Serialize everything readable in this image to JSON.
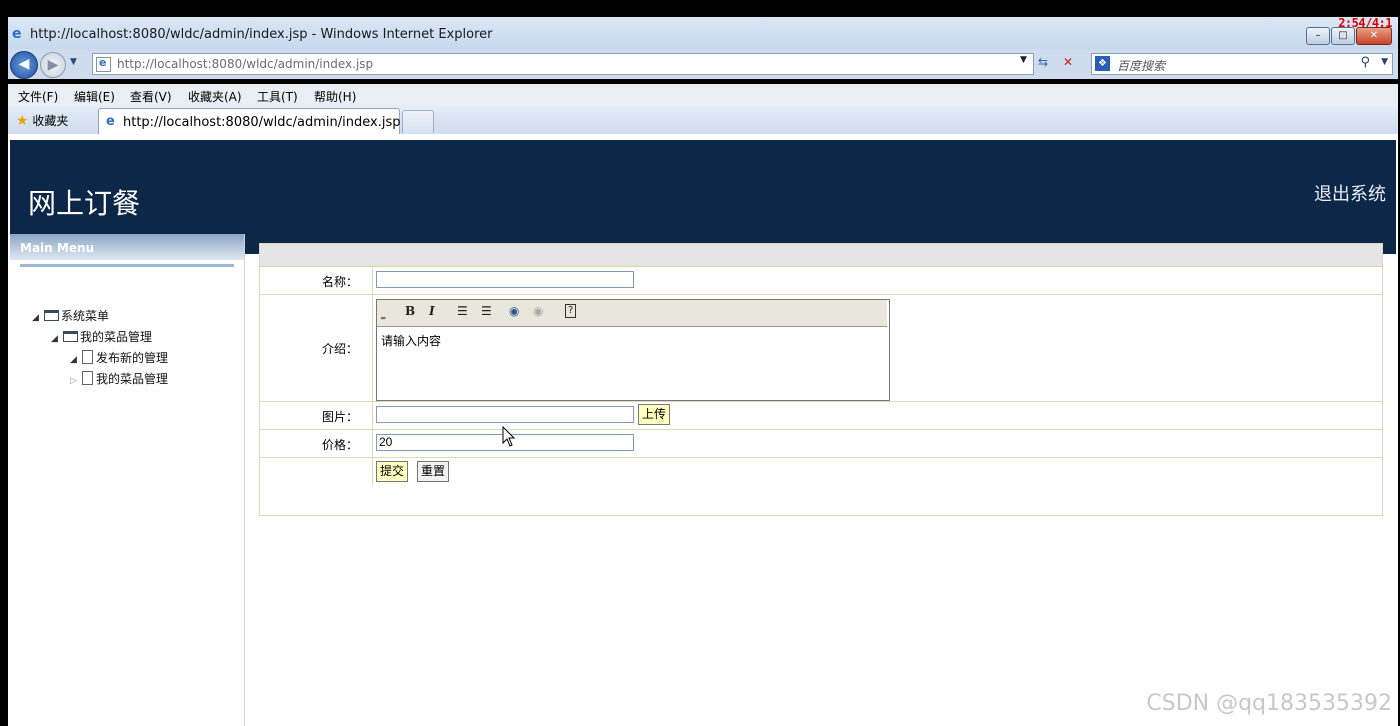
{
  "window": {
    "title": "http://localhost:8080/wldc/admin/index.jsp - Windows Internet Explorer",
    "timer_overlay": "2:54/4:1",
    "buttons": {
      "minimize": "–",
      "maximize": "□",
      "close": "✕"
    }
  },
  "address_bar": {
    "url": "http://localhost:8080/wldc/admin/index.jsp",
    "search_placeholder": "百度搜索"
  },
  "menu": [
    "文件(F)",
    "编辑(E)",
    "查看(V)",
    "收藏夹(A)",
    "工具(T)",
    "帮助(H)"
  ],
  "favorites_label": "收藏夹",
  "tab_title": "http://localhost:8080/wldc/admin/index.jsp",
  "header": {
    "site_title": "网上订餐",
    "logout": "退出系统"
  },
  "sidebar": {
    "heading": "Main Menu",
    "tree": [
      {
        "label": "系统菜单"
      },
      {
        "label": "我的菜品管理"
      },
      {
        "label": "发布新的管理"
      },
      {
        "label": "我的菜品管理"
      }
    ]
  },
  "form": {
    "name_label": "名称：",
    "name_value": "",
    "intro_label": "介绍：",
    "intro_value": "请输入内容",
    "image_label": "图片：",
    "image_value": "",
    "upload_button": "上传",
    "price_label": "价格：",
    "price_value": "20",
    "submit_button": "提交",
    "reset_button": "重置"
  },
  "watermark": "CSDN @qq183535392",
  "icons": [
    "ie-icon",
    "back-icon",
    "forward-icon",
    "refresh-icon",
    "stop-icon",
    "search-icon",
    "star-icon",
    "folder-icon",
    "file-icon",
    "bold-icon",
    "italic-icon",
    "ordered-list-icon",
    "unordered-list-icon",
    "link-icon",
    "unlink-icon",
    "help-icon",
    "cursor-icon"
  ]
}
